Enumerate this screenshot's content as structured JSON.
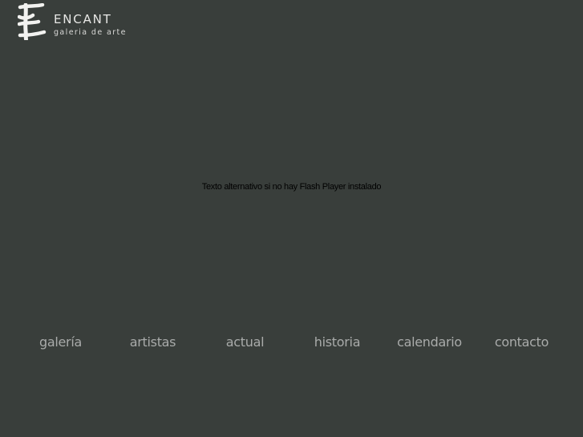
{
  "brand": {
    "name": "ENCANT",
    "tagline": "galeria de arte"
  },
  "flash_fallback_text": "Texto alternativo si no hay Flash Player instalado",
  "nav": {
    "items": [
      {
        "label": "galería"
      },
      {
        "label": "artistas"
      },
      {
        "label": "actual"
      },
      {
        "label": "historia"
      },
      {
        "label": "calendario"
      },
      {
        "label": "contacto"
      }
    ]
  },
  "colors": {
    "background": "#393e3b",
    "logo": "#e8e8e6",
    "nav_text": "#a9abaa",
    "fallback_text": "#000000"
  }
}
